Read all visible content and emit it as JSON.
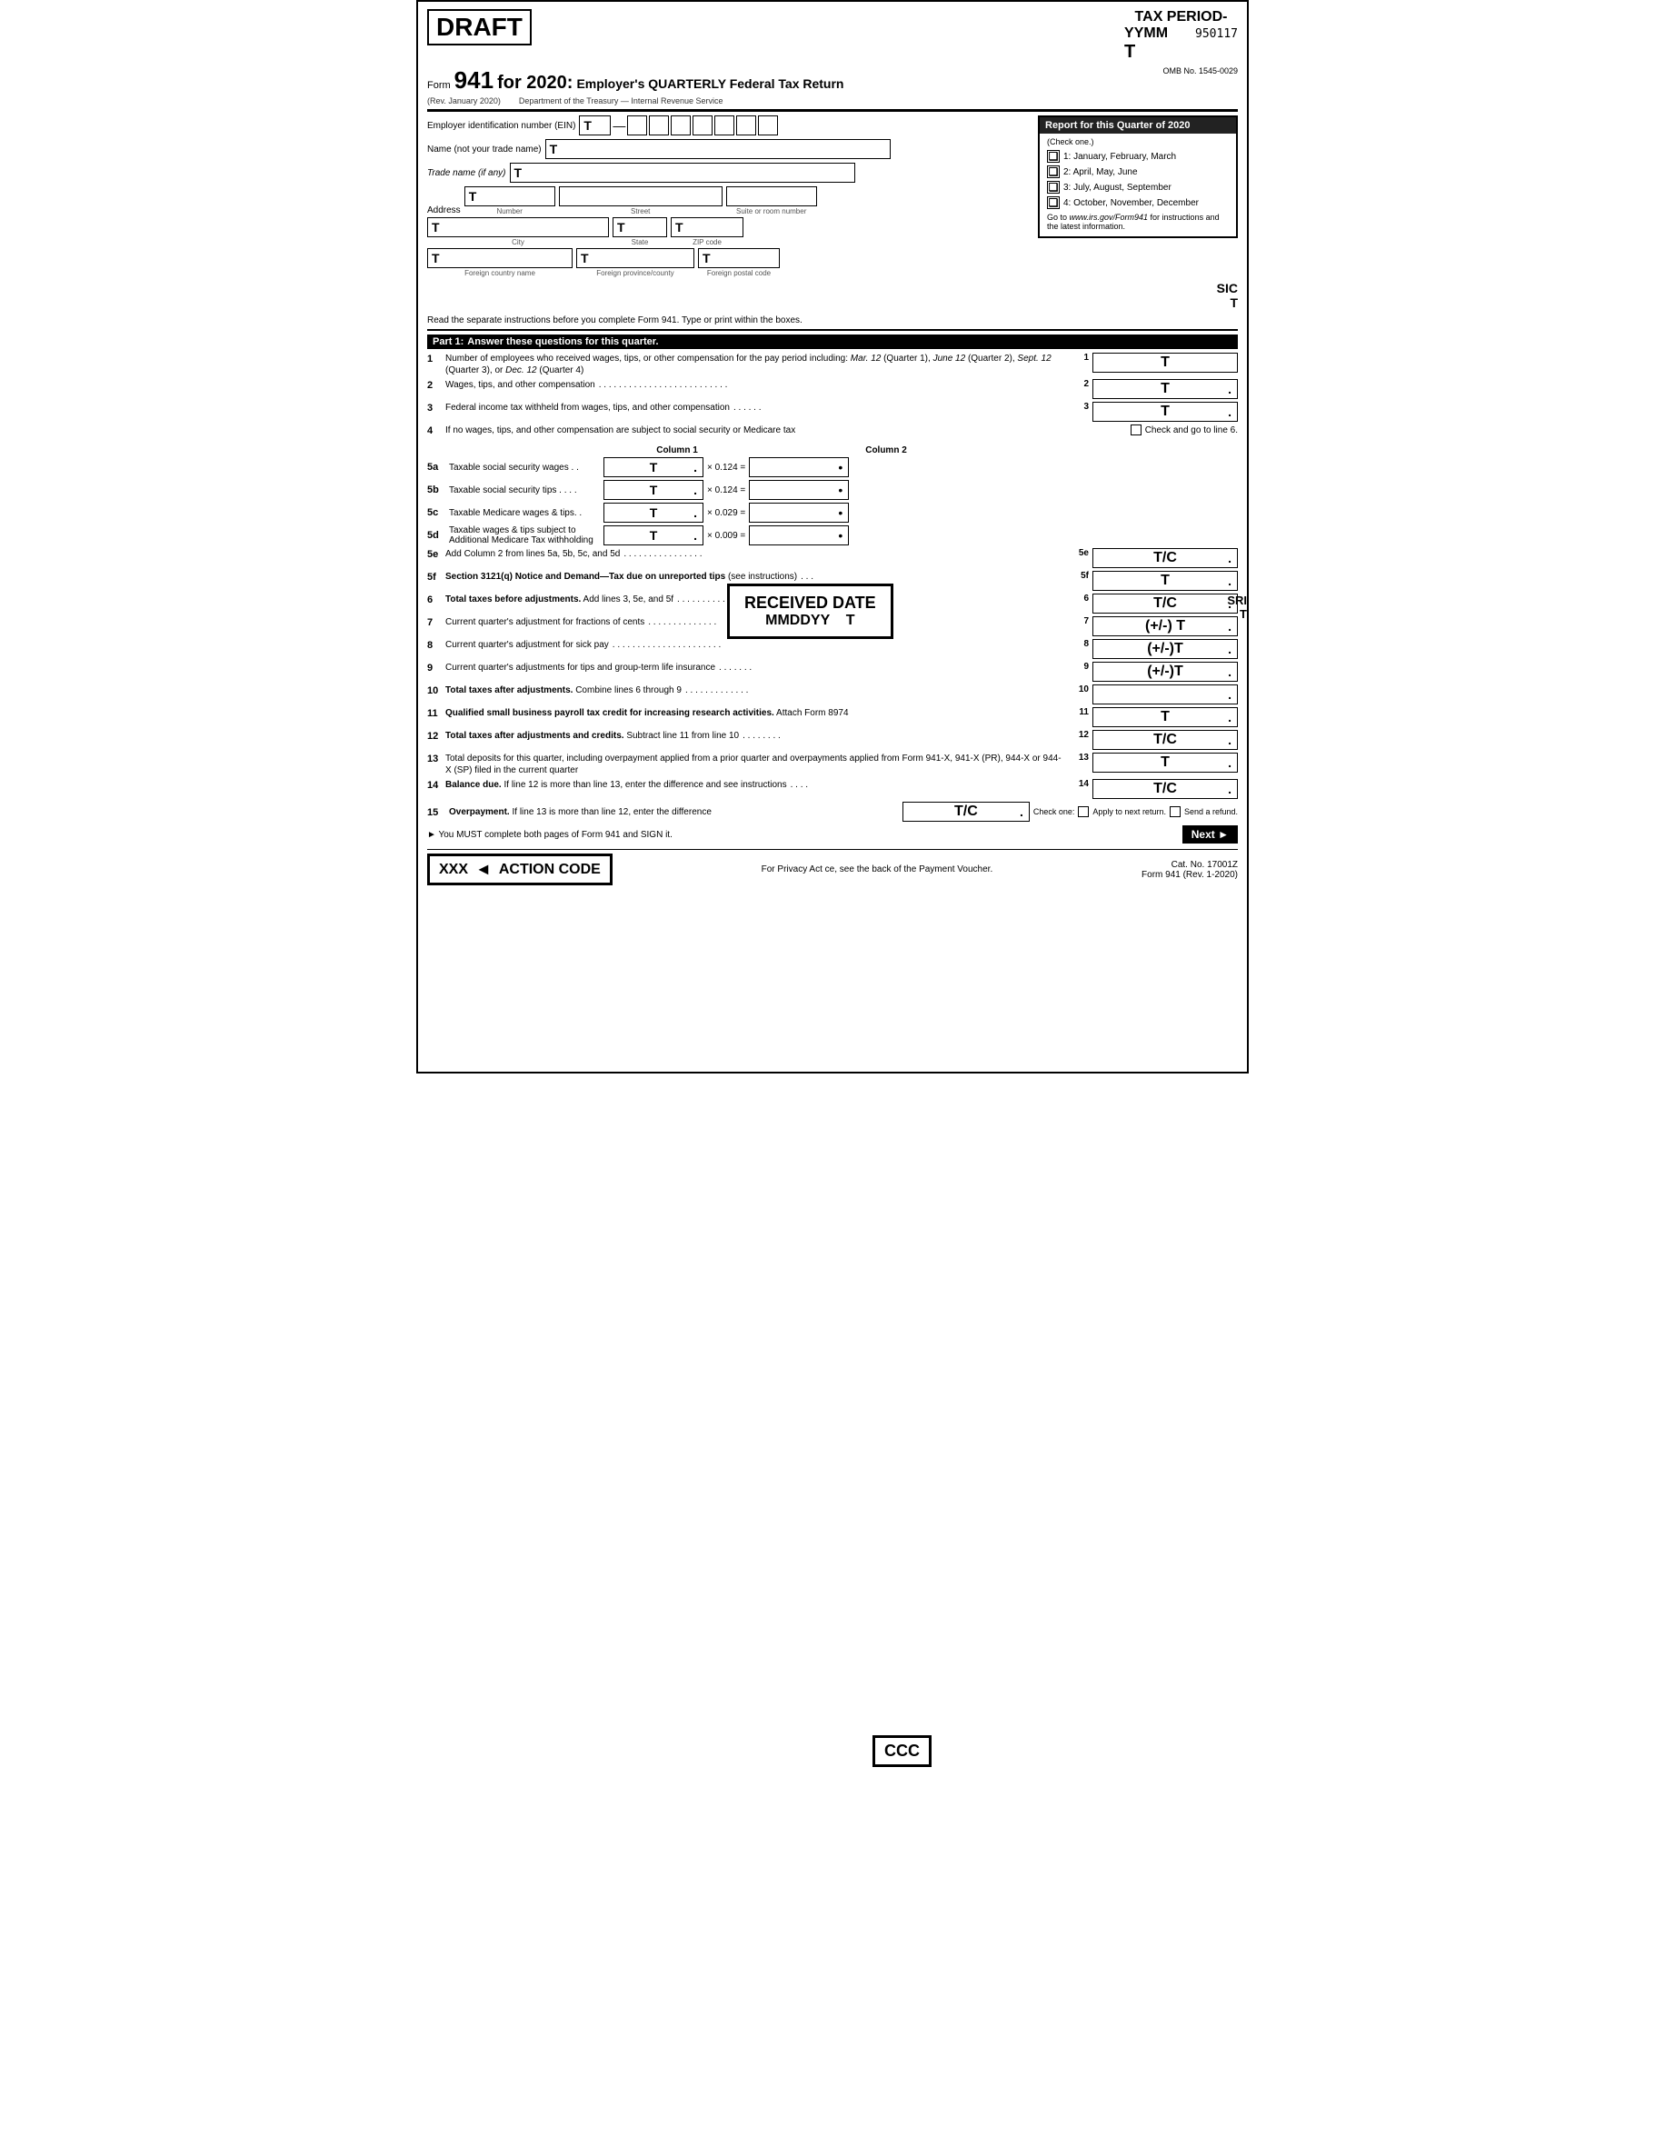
{
  "header": {
    "draft_label": "DRAFT",
    "tax_period_title": "TAX PERIOD-",
    "yymm_label": "YYMM",
    "seq_number": "950117",
    "t_label": "T",
    "omb": "OMB No. 1545-0029",
    "form_label": "Form",
    "form_number": "941",
    "form_for": "for 2020:",
    "form_description": "Employer's QUARTERLY Federal Tax Return",
    "rev_date": "(Rev. January 2020)",
    "department": "Department of the Treasury — Internal Revenue Service"
  },
  "fields": {
    "ein_label": "Employer identification number (EIN)",
    "ein_t": "T",
    "name_label": "Name (not your trade name)",
    "name_t": "T",
    "trade_label": "Trade name (if any)",
    "trade_t": "T",
    "address_label": "Address",
    "address_t": "T",
    "number_label": "Number",
    "street_label": "Street",
    "suite_label": "Suite or room number",
    "city_t": "T",
    "city_label": "City",
    "state_t": "T",
    "state_label": "State",
    "zip_t": "T",
    "zip_label": "ZIP code",
    "foreign_country_t": "T",
    "foreign_country_label": "Foreign country name",
    "foreign_province_t": "T",
    "foreign_province_label": "Foreign province/county",
    "foreign_postal_t": "T",
    "foreign_postal_label": "Foreign postal code"
  },
  "quarter_box": {
    "title": "Report for this Quarter of 2020",
    "check_label": "(Check one.)",
    "items": [
      {
        "num": "1",
        "label": "1: January, February, March"
      },
      {
        "num": "2",
        "label": "2: April, May, June"
      },
      {
        "num": "3",
        "label": "3: July, August, September"
      },
      {
        "num": "4",
        "label": "4: October, November, December"
      }
    ],
    "note": "Go to www.irs.gov/Form941 for\ninstructions and the latest information."
  },
  "sic_label": "SIC",
  "sic_t": "T",
  "instructions": "Read the separate instructions before you complete Form 941. Type or print within the boxes.",
  "part1": {
    "label": "Part 1:",
    "title": "Answer these questions for this quarter.",
    "lines": [
      {
        "num": "1",
        "desc": "Number of employees who received wages, tips, or other compensation for the pay period including: Mar. 12 (Quarter 1), June 12 (Quarter 2), Sept. 12 (Quarter 3), or Dec. 12 (Quarter 4)",
        "ref": "1",
        "value": "T",
        "has_dot": false
      },
      {
        "num": "2",
        "desc": "Wages, tips, and other compensation",
        "ref": "2",
        "value": "T",
        "has_dot": true,
        "dots": true
      },
      {
        "num": "3",
        "desc": "Federal income tax withheld from wages, tips, and other compensation",
        "ref": "3",
        "value": "T",
        "has_dot": true,
        "dots": true
      }
    ]
  },
  "line4": {
    "num": "4",
    "desc": "If no wages, tips, and other compensation are subject to social security or Medicare tax",
    "check_text": "Check and go to line 6."
  },
  "cols_header": {
    "col1": "Column 1",
    "col2": "Column 2"
  },
  "lines_5x": [
    {
      "num": "5a",
      "desc": "Taxable social security wages . .",
      "col1_value": "T",
      "multiplier": "× 0.124 =",
      "col2_dot": "•"
    },
    {
      "num": "5b",
      "desc": "Taxable social security tips . . . .",
      "col1_value": "T",
      "multiplier": "× 0.124 =",
      "col2_dot": "•"
    },
    {
      "num": "5c",
      "desc": "Taxable Medicare wages & tips. .",
      "col1_value": "T",
      "multiplier": "× 0.029 =",
      "col2_dot": "•"
    },
    {
      "num": "5d",
      "desc": "Taxable wages & tips subject to Additional Medicare Tax withholding",
      "col1_value": "T",
      "multiplier": "× 0.009 =",
      "col2_dot": "•"
    }
  ],
  "line5e": {
    "num": "5e",
    "desc": "Add Column 2 from lines 5a, 5b, 5c, and 5d",
    "ref": "5e",
    "value": "T/C",
    "has_dot": true
  },
  "line5f": {
    "num": "5f",
    "desc": "Section 3121(q) Notice and Demand—Tax due on unreported tips (see instructions)",
    "ref": "5f",
    "value": "T",
    "has_dot": true
  },
  "line6": {
    "num": "6",
    "desc": "Total taxes before adjustments. Add lines 3, 5e, and 5f",
    "ref": "6",
    "value": "T/C",
    "has_dot": true
  },
  "sri_label": "SRI",
  "sri_t": "T",
  "line7": {
    "num": "7",
    "desc": "Current quarter's adjustment for fractions of cents",
    "ref": "7",
    "value": "(+/-) T",
    "has_dot": true
  },
  "line8": {
    "num": "8",
    "desc": "Current quarter's adjustment for sick pay",
    "ref": "8",
    "value": "(+/-)T",
    "has_dot": true
  },
  "line9": {
    "num": "9",
    "desc": "Current quarter's adjustments for tips and group-term life insurance",
    "ref": "9",
    "value": "(+/-)T",
    "has_dot": true
  },
  "line10": {
    "num": "10",
    "desc": "Total taxes after adjustments. Combine lines 6 through 9",
    "ref": "10",
    "value": "",
    "has_dot": true
  },
  "line11": {
    "num": "11",
    "desc": "Qualified small business payroll tax credit for increasing research activities. Attach Form 8974",
    "ref": "11",
    "value": "T",
    "has_dot": true
  },
  "line12": {
    "num": "12",
    "desc": "Total taxes after adjustments and credits. Subtract line 11 from line 10",
    "ref": "12",
    "value": "T/C",
    "has_dot": true
  },
  "line13": {
    "num": "13",
    "desc": "Total deposits for this quarter, including overpayment applied from a prior quarter and overpayments applied from Form 941-X, 941-X (PR), 944-X or 944-X (SP) filed in the current quarter",
    "ref": "13",
    "value": "T",
    "has_dot": true
  },
  "line14": {
    "num": "14",
    "desc": "Balance due. If line 12 is more than line 13, enter the difference and see instructions",
    "ref": "14",
    "value": "T/C",
    "has_dot": true
  },
  "ccc_label": "CCC",
  "line15": {
    "num": "15",
    "desc": "Overpayment. If line 13 is more than line 12, enter the difference",
    "value": "T/C",
    "has_dot": true,
    "check_one": "Check one:",
    "apply_label": "Apply to next return.",
    "refund_label": "Send a refund."
  },
  "must_complete": "► You MUST complete both pages of Form 941 and SIGN it.",
  "next_btn": "Next ►",
  "footer": {
    "privacy_text": "For Privacy Act",
    "privacy_rest": "ce, see the back of the Payment Voucher.",
    "cat_no": "Cat. No. 17001Z",
    "form_ref": "Form 941 (Rev. 1-2020)"
  },
  "action_code": {
    "label": "ACTION CODE",
    "value": "XXX",
    "arrow": "◄"
  },
  "received_date": {
    "title": "RECEIVED DATE",
    "mmddyy": "MMDDYY",
    "t": "T"
  }
}
